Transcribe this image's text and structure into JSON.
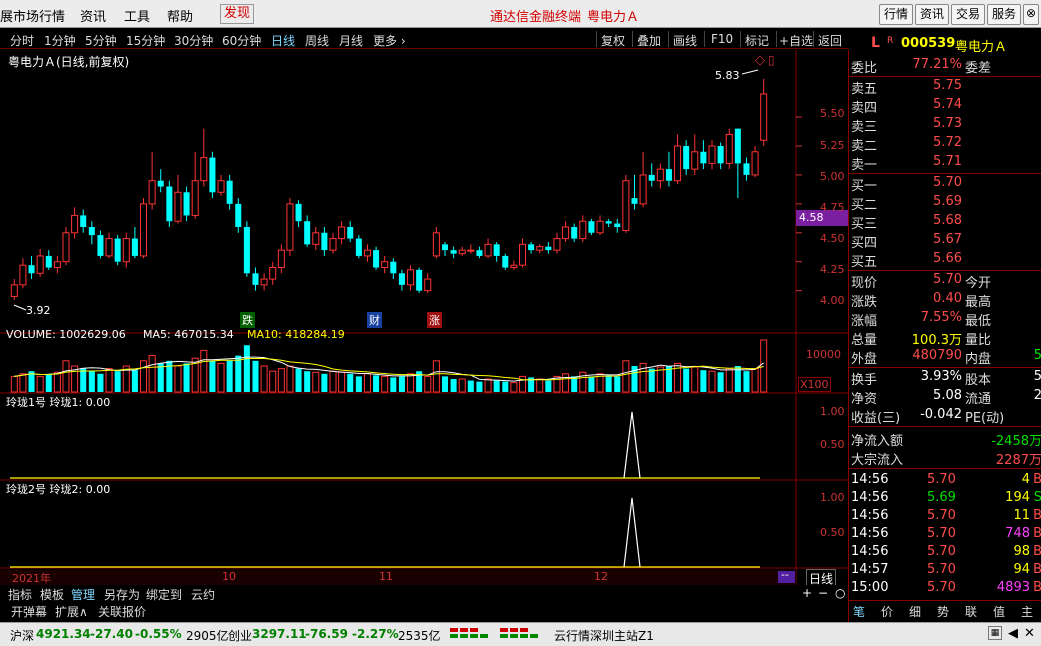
{
  "menubar": {
    "items": [
      "展市场行情",
      "资讯",
      "工具",
      "帮助",
      "发现"
    ],
    "center_title": "通达信金融终端",
    "center_stock": "粤电力Ａ",
    "right_buttons": [
      "行情",
      "资讯",
      "交易",
      "服务"
    ]
  },
  "periodbar": {
    "periods": [
      "分时",
      "1分钟",
      "5分钟",
      "15分钟",
      "30分钟",
      "60分钟",
      "日线",
      "周线",
      "月线",
      "更多 ›"
    ],
    "selected": "日线",
    "tools": [
      "复权",
      "叠加",
      "画线",
      "F10",
      "标记",
      "+自选",
      "返回"
    ]
  },
  "chart": {
    "title": "粤电力Ａ(日线,前复权)",
    "price_ticks": [
      "5.50",
      "5.25",
      "5.00",
      "4.75",
      "4.50",
      "4.25",
      "4.00"
    ],
    "current_price_tag": "4.58",
    "high_label": "5.83",
    "low_label": "3.92",
    "event_tags": [
      "跌",
      "财",
      "涨"
    ],
    "volume_label": "VOLUME: 1002629.06",
    "ma5_label": "MA5: 467015.34",
    "ma10_label": "MA10: 418284.19",
    "volume_tick": "10000",
    "volume_unit": "X100",
    "ind1_label": "玲珑1号  玲珑1: 0.00",
    "ind1_ticks": [
      "1.00",
      "0.50"
    ],
    "ind2_label": "玲珑2号  玲珑2: 0.00",
    "ind2_ticks": [
      "1.00",
      "0.50"
    ],
    "date_labels": [
      "2021年",
      "10",
      "11",
      "12"
    ],
    "period_name": "日线"
  },
  "bottomtabs": {
    "row1": [
      "指标",
      "模板",
      "管理",
      "另存为",
      "绑定到",
      "云约"
    ],
    "row1_selected": "管理",
    "row2": [
      "开弹幕",
      "扩展∧",
      "关联报价"
    ]
  },
  "quote": {
    "code_prefix": "L",
    "code_flag": "R",
    "code": "000539",
    "name": "粤电力Ａ",
    "weibi_label": "委比",
    "weibi": "77.21%",
    "weicha_label": "委差",
    "asks": [
      {
        "label": "卖五",
        "price": "5.75"
      },
      {
        "label": "卖四",
        "price": "5.74"
      },
      {
        "label": "卖三",
        "price": "5.73"
      },
      {
        "label": "卖二",
        "price": "5.72"
      },
      {
        "label": "卖一",
        "price": "5.71"
      }
    ],
    "bids": [
      {
        "label": "买一",
        "price": "5.70"
      },
      {
        "label": "买二",
        "price": "5.69"
      },
      {
        "label": "买三",
        "price": "5.68"
      },
      {
        "label": "买四",
        "price": "5.67"
      },
      {
        "label": "买五",
        "price": "5.66"
      }
    ],
    "stats": [
      {
        "l": "现价",
        "v": "5.70",
        "l2": "今开",
        "v2": ""
      },
      {
        "l": "涨跌",
        "v": "0.40",
        "l2": "最高",
        "v2": ""
      },
      {
        "l": "涨幅",
        "v": "7.55%",
        "l2": "最低",
        "v2": ""
      },
      {
        "l": "总量",
        "v": "100.3万",
        "l2": "量比",
        "v2": ""
      },
      {
        "l": "外盘",
        "v": "480790",
        "l2": "内盘",
        "v2": "5"
      }
    ],
    "stats2": [
      {
        "l": "换手",
        "v": "3.93%",
        "l2": "股本",
        "v2": "5"
      },
      {
        "l": "净资",
        "v": "5.08",
        "l2": "流通",
        "v2": "2"
      },
      {
        "l": "收益(三)",
        "v": "-0.042",
        "l2": "PE(动)",
        "v2": ""
      }
    ],
    "flow": [
      {
        "l": "净流入额",
        "v": "-2458万"
      },
      {
        "l": "大宗流入",
        "v": "2287万"
      }
    ],
    "ticks": [
      {
        "t": "14:56",
        "p": "5.70",
        "q": "4",
        "s": "B"
      },
      {
        "t": "14:56",
        "p": "5.69",
        "q": "194",
        "s": "S"
      },
      {
        "t": "14:56",
        "p": "5.70",
        "q": "11",
        "s": "B"
      },
      {
        "t": "14:56",
        "p": "5.70",
        "q": "748",
        "s": "B"
      },
      {
        "t": "14:56",
        "p": "5.70",
        "q": "98",
        "s": "B"
      },
      {
        "t": "14:57",
        "p": "5.70",
        "q": "94",
        "s": "B"
      },
      {
        "t": "15:00",
        "p": "5.70",
        "q": "4893",
        "s": "B"
      }
    ],
    "tabs": [
      "笔",
      "价",
      "细",
      "势",
      "联",
      "值",
      "主"
    ]
  },
  "statusbar": {
    "sh_name": "沪深",
    "sh_value": "4921.34",
    "sh_change": "-27.40",
    "sh_pct": "-0.55%",
    "sh_amount": "2905亿",
    "cy_name": "创业",
    "cy_value": "3297.11",
    "cy_change": "-76.59",
    "cy_pct": "-2.27%",
    "cy_amount": "2535亿",
    "server": "云行情深圳主站Z1"
  },
  "chart_data": {
    "type": "candlestick",
    "ylim": [
      3.85,
      5.95
    ],
    "candles": [
      [
        3.95,
        4.05,
        3.92,
        4.1
      ],
      [
        4.05,
        4.22,
        4.02,
        4.28
      ],
      [
        4.22,
        4.15,
        4.1,
        4.3
      ],
      [
        4.15,
        4.3,
        4.12,
        4.36
      ],
      [
        4.3,
        4.2,
        4.18,
        4.35
      ],
      [
        4.2,
        4.25,
        4.15,
        4.3
      ],
      [
        4.25,
        4.5,
        4.22,
        4.55
      ],
      [
        4.5,
        4.65,
        4.45,
        4.72
      ],
      [
        4.65,
        4.55,
        4.5,
        4.7
      ],
      [
        4.55,
        4.48,
        4.4,
        4.6
      ],
      [
        4.48,
        4.3,
        4.28,
        4.52
      ],
      [
        4.3,
        4.45,
        4.28,
        4.5
      ],
      [
        4.45,
        4.25,
        4.22,
        4.48
      ],
      [
        4.25,
        4.45,
        4.2,
        4.5
      ],
      [
        4.45,
        4.3,
        4.28,
        4.55
      ],
      [
        4.3,
        4.75,
        4.28,
        4.8
      ],
      [
        4.75,
        4.95,
        4.7,
        5.2
      ],
      [
        4.95,
        4.9,
        4.85,
        5.05
      ],
      [
        4.9,
        4.6,
        4.55,
        4.95
      ],
      [
        4.6,
        4.85,
        4.58,
        5.0
      ],
      [
        4.85,
        4.65,
        4.6,
        4.9
      ],
      [
        4.65,
        4.95,
        4.62,
        5.2
      ],
      [
        4.95,
        5.15,
        4.9,
        5.4
      ],
      [
        5.15,
        4.85,
        4.8,
        5.2
      ],
      [
        4.85,
        4.95,
        4.82,
        5.0
      ],
      [
        4.95,
        4.75,
        4.7,
        5.0
      ],
      [
        4.75,
        4.55,
        4.5,
        4.8
      ],
      [
        4.55,
        4.15,
        4.12,
        4.6
      ],
      [
        4.15,
        4.05,
        4.0,
        4.2
      ],
      [
        4.05,
        4.1,
        4.0,
        4.15
      ],
      [
        4.1,
        4.2,
        4.05,
        4.25
      ],
      [
        4.2,
        4.35,
        4.15,
        4.4
      ],
      [
        4.35,
        4.75,
        4.3,
        4.8
      ],
      [
        4.75,
        4.6,
        4.55,
        4.78
      ],
      [
        4.6,
        4.4,
        4.38,
        4.65
      ],
      [
        4.4,
        4.5,
        4.35,
        4.55
      ],
      [
        4.5,
        4.35,
        4.3,
        4.55
      ],
      [
        4.35,
        4.45,
        4.32,
        4.5
      ],
      [
        4.45,
        4.55,
        4.4,
        4.6
      ],
      [
        4.55,
        4.45,
        4.42,
        4.6
      ],
      [
        4.45,
        4.3,
        4.28,
        4.48
      ],
      [
        4.3,
        4.35,
        4.25,
        4.4
      ],
      [
        4.35,
        4.2,
        4.18,
        4.38
      ],
      [
        4.2,
        4.25,
        4.15,
        4.3
      ],
      [
        4.25,
        4.15,
        4.1,
        4.28
      ],
      [
        4.15,
        4.05,
        4.0,
        4.18
      ],
      [
        4.05,
        4.18,
        4.0,
        4.22
      ],
      [
        4.18,
        4.0,
        3.98,
        4.2
      ],
      [
        4.0,
        4.1,
        3.98,
        4.15
      ],
      [
        4.3,
        4.5,
        4.28,
        4.55
      ],
      [
        4.4,
        4.35,
        4.3,
        4.42
      ],
      [
        4.35,
        4.32,
        4.28,
        4.38
      ],
      [
        4.32,
        4.35,
        4.3,
        4.38
      ],
      [
        4.35,
        4.35,
        4.32,
        4.4
      ],
      [
        4.35,
        4.3,
        4.28,
        4.38
      ],
      [
        4.3,
        4.4,
        4.28,
        4.45
      ],
      [
        4.4,
        4.3,
        4.25,
        4.42
      ],
      [
        4.3,
        4.2,
        4.18,
        4.32
      ],
      [
        4.2,
        4.22,
        4.18,
        4.26
      ],
      [
        4.22,
        4.4,
        4.2,
        4.45
      ],
      [
        4.4,
        4.35,
        4.32,
        4.42
      ],
      [
        4.35,
        4.38,
        4.32,
        4.4
      ],
      [
        4.38,
        4.35,
        4.32,
        4.42
      ],
      [
        4.35,
        4.45,
        4.32,
        4.5
      ],
      [
        4.45,
        4.55,
        4.42,
        4.6
      ],
      [
        4.55,
        4.45,
        4.42,
        4.58
      ],
      [
        4.45,
        4.6,
        4.42,
        4.65
      ],
      [
        4.6,
        4.5,
        4.48,
        4.62
      ],
      [
        4.5,
        4.6,
        4.48,
        4.65
      ],
      [
        4.6,
        4.58,
        4.55,
        4.62
      ],
      [
        4.58,
        4.55,
        4.5,
        4.62
      ],
      [
        4.52,
        4.95,
        4.5,
        5.0
      ],
      [
        4.8,
        4.75,
        4.7,
        5.0
      ],
      [
        4.75,
        5.0,
        4.72,
        5.2
      ],
      [
        5.0,
        4.95,
        4.9,
        5.1
      ],
      [
        4.95,
        5.05,
        4.88,
        5.1
      ],
      [
        5.05,
        4.95,
        4.9,
        5.2
      ],
      [
        4.95,
        5.25,
        4.92,
        5.35
      ],
      [
        5.25,
        5.05,
        5.0,
        5.3
      ],
      [
        5.05,
        5.2,
        5.0,
        5.35
      ],
      [
        5.2,
        5.1,
        5.05,
        5.3
      ],
      [
        5.1,
        5.25,
        5.05,
        5.3
      ],
      [
        5.25,
        5.1,
        5.05,
        5.28
      ],
      [
        5.1,
        5.35,
        5.05,
        5.4
      ],
      [
        5.4,
        5.1,
        4.8,
        5.4
      ],
      [
        5.1,
        5.0,
        4.95,
        5.15
      ],
      [
        5.0,
        5.2,
        4.98,
        5.25
      ],
      [
        5.3,
        5.7,
        5.25,
        5.83
      ]
    ],
    "volume": [
      30,
      35,
      40,
      30,
      35,
      38,
      60,
      50,
      45,
      40,
      35,
      45,
      40,
      50,
      42,
      60,
      70,
      55,
      60,
      50,
      55,
      65,
      80,
      60,
      55,
      60,
      70,
      90,
      60,
      50,
      40,
      45,
      50,
      45,
      40,
      38,
      35,
      40,
      38,
      35,
      30,
      35,
      32,
      30,
      28,
      30,
      35,
      40,
      30,
      60,
      30,
      25,
      25,
      22,
      20,
      25,
      22,
      20,
      18,
      30,
      28,
      25,
      22,
      30,
      35,
      30,
      38,
      30,
      35,
      32,
      30,
      60,
      50,
      55,
      45,
      48,
      50,
      55,
      45,
      48,
      42,
      40,
      38,
      45,
      50,
      40,
      45,
      100
    ],
    "volume_up": [
      true,
      true,
      false,
      true,
      false,
      true,
      true,
      true,
      false,
      false,
      false,
      true,
      false,
      true,
      false,
      true,
      true,
      false,
      false,
      true,
      false,
      true,
      true,
      false,
      true,
      false,
      false,
      false,
      false,
      true,
      true,
      true,
      true,
      false,
      false,
      true,
      false,
      true,
      true,
      false,
      false,
      true,
      false,
      true,
      false,
      false,
      true,
      false,
      true,
      true,
      false,
      false,
      true,
      false,
      false,
      true,
      false,
      false,
      true,
      true,
      false,
      true,
      false,
      true,
      true,
      false,
      true,
      false,
      true,
      false,
      false,
      true,
      false,
      true,
      false,
      true,
      false,
      true,
      false,
      true,
      false,
      true,
      false,
      true,
      false,
      false,
      true,
      true
    ]
  }
}
